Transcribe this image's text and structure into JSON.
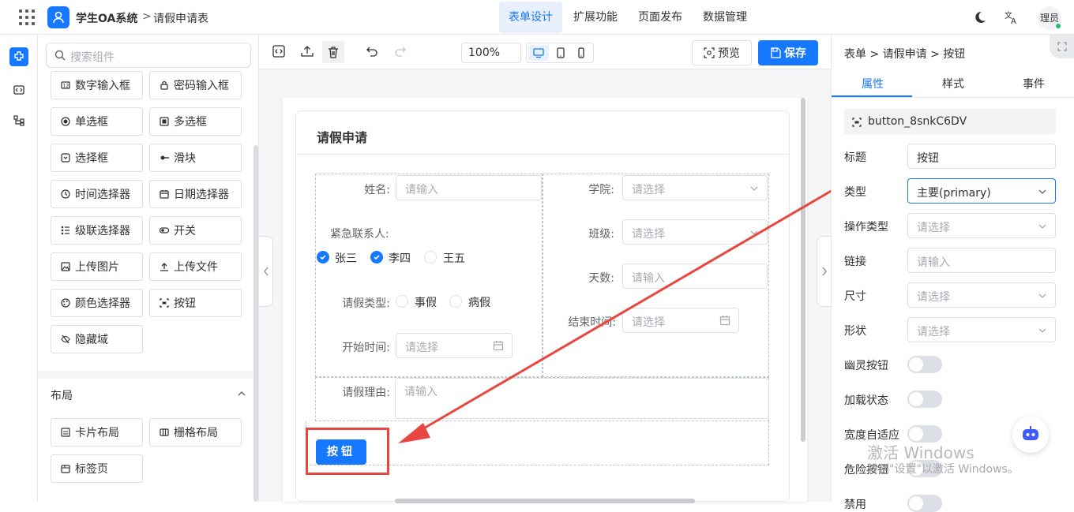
{
  "header": {
    "app_title": "学生OA系统",
    "breadcrumb_sep": ">",
    "page_title": "请假申请表",
    "nav": [
      "表单设计",
      "扩展功能",
      "页面发布",
      "数据管理"
    ],
    "active_nav": 0,
    "avatar_text": "理员"
  },
  "components": {
    "search_placeholder": "搜索组件",
    "items": [
      "数字输入框",
      "密码输入框",
      "单选框",
      "多选框",
      "选择框",
      "滑块",
      "时间选择器",
      "日期选择器",
      "级联选择器",
      "开关",
      "上传图片",
      "上传文件",
      "颜色选择器",
      "按钮",
      "隐藏域"
    ],
    "layout_title": "布局",
    "layout_items": [
      "卡片布局",
      "栅格布局",
      "标签页"
    ]
  },
  "toolbar": {
    "zoom": "100%",
    "preview_label": "预览",
    "save_label": "保存"
  },
  "form": {
    "card_title": "请假申请",
    "name_label": "姓名:",
    "name_placeholder": "请输入",
    "college_label": "学院:",
    "college_placeholder": "请选择",
    "contact_label": "紧急联系人:",
    "contacts": [
      {
        "label": "张三",
        "checked": true
      },
      {
        "label": "李四",
        "checked": true
      },
      {
        "label": "王五",
        "checked": false
      }
    ],
    "class_label": "班级:",
    "class_placeholder": "请选择",
    "days_label": "天数:",
    "days_placeholder": "请输入",
    "leave_type_label": "请假类型:",
    "leave_types": [
      "事假",
      "病假"
    ],
    "end_time_label": "结束时间:",
    "end_time_placeholder": "请选择",
    "start_time_label": "开始时间:",
    "start_time_placeholder": "请选择",
    "reason_label": "请假理由:",
    "reason_placeholder": "请输入",
    "button_label": "按钮"
  },
  "props": {
    "breadcrumb": "表单 > 请假申请 > 按钮",
    "tabs": [
      "属性",
      "样式",
      "事件"
    ],
    "active_tab": 0,
    "component_id": "button_8snkC6DV",
    "fields": {
      "title_label": "标题",
      "title_value": "按钮",
      "type_label": "类型",
      "type_value": "主要(primary)",
      "action_label": "操作类型",
      "action_placeholder": "请选择",
      "link_label": "链接",
      "link_placeholder": "请输入",
      "size_label": "尺寸",
      "size_placeholder": "请选择",
      "shape_label": "形状",
      "shape_placeholder": "请选择",
      "ghost_label": "幽灵按钮",
      "loading_label": "加载状态",
      "block_label": "宽度自适应",
      "danger_label": "危险按钮",
      "disabled_label": "禁用"
    },
    "toggles": {
      "ghost": false,
      "loading": false,
      "block": false,
      "danger": false,
      "disabled": false
    }
  },
  "watermark": {
    "line1": "激活 Windows",
    "line2": "转到\"设置\"以激活 Windows。"
  },
  "colors": {
    "primary": "#1677ff",
    "annotation": "#e8473f"
  }
}
